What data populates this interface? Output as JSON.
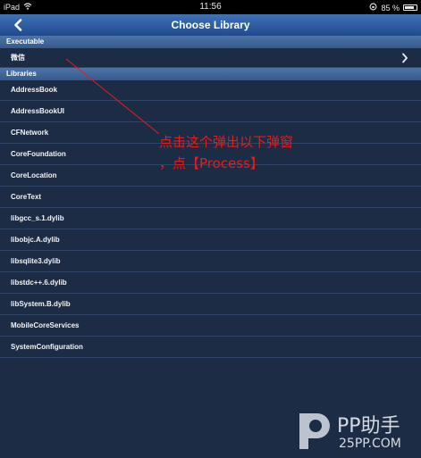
{
  "status_bar": {
    "device": "iPad",
    "time": "11:56",
    "battery": "85 %",
    "battery_level": 0.85
  },
  "nav_bar": {
    "title": "Choose Library",
    "back_icon": "chevron-left-icon"
  },
  "executable": {
    "header": "Executable",
    "item": "微信",
    "item_icon": "chevron-right-icon"
  },
  "libraries": {
    "header": "Libraries",
    "items": [
      "AddressBook",
      "AddressBookUI",
      "CFNetwork",
      "CoreFoundation",
      "CoreLocation",
      "CoreText",
      "libgcc_s.1.dylib",
      "libobjc.A.dylib",
      "libsqlite3.dylib",
      "libstdc++.6.dylib",
      "libSystem.B.dylib",
      "MobileCoreServices",
      "SystemConfiguration"
    ]
  },
  "annotation": {
    "line1": "点击这个弹出以下弹窗",
    "line2": "，点【Process】",
    "color": "#e81c1c"
  },
  "watermark": {
    "brand": "PP助手",
    "url": "25PP.COM"
  },
  "colors": {
    "nav_bar": "#2c5ea2",
    "list_background": "#1c2c44",
    "section_header": "#4468a0"
  }
}
